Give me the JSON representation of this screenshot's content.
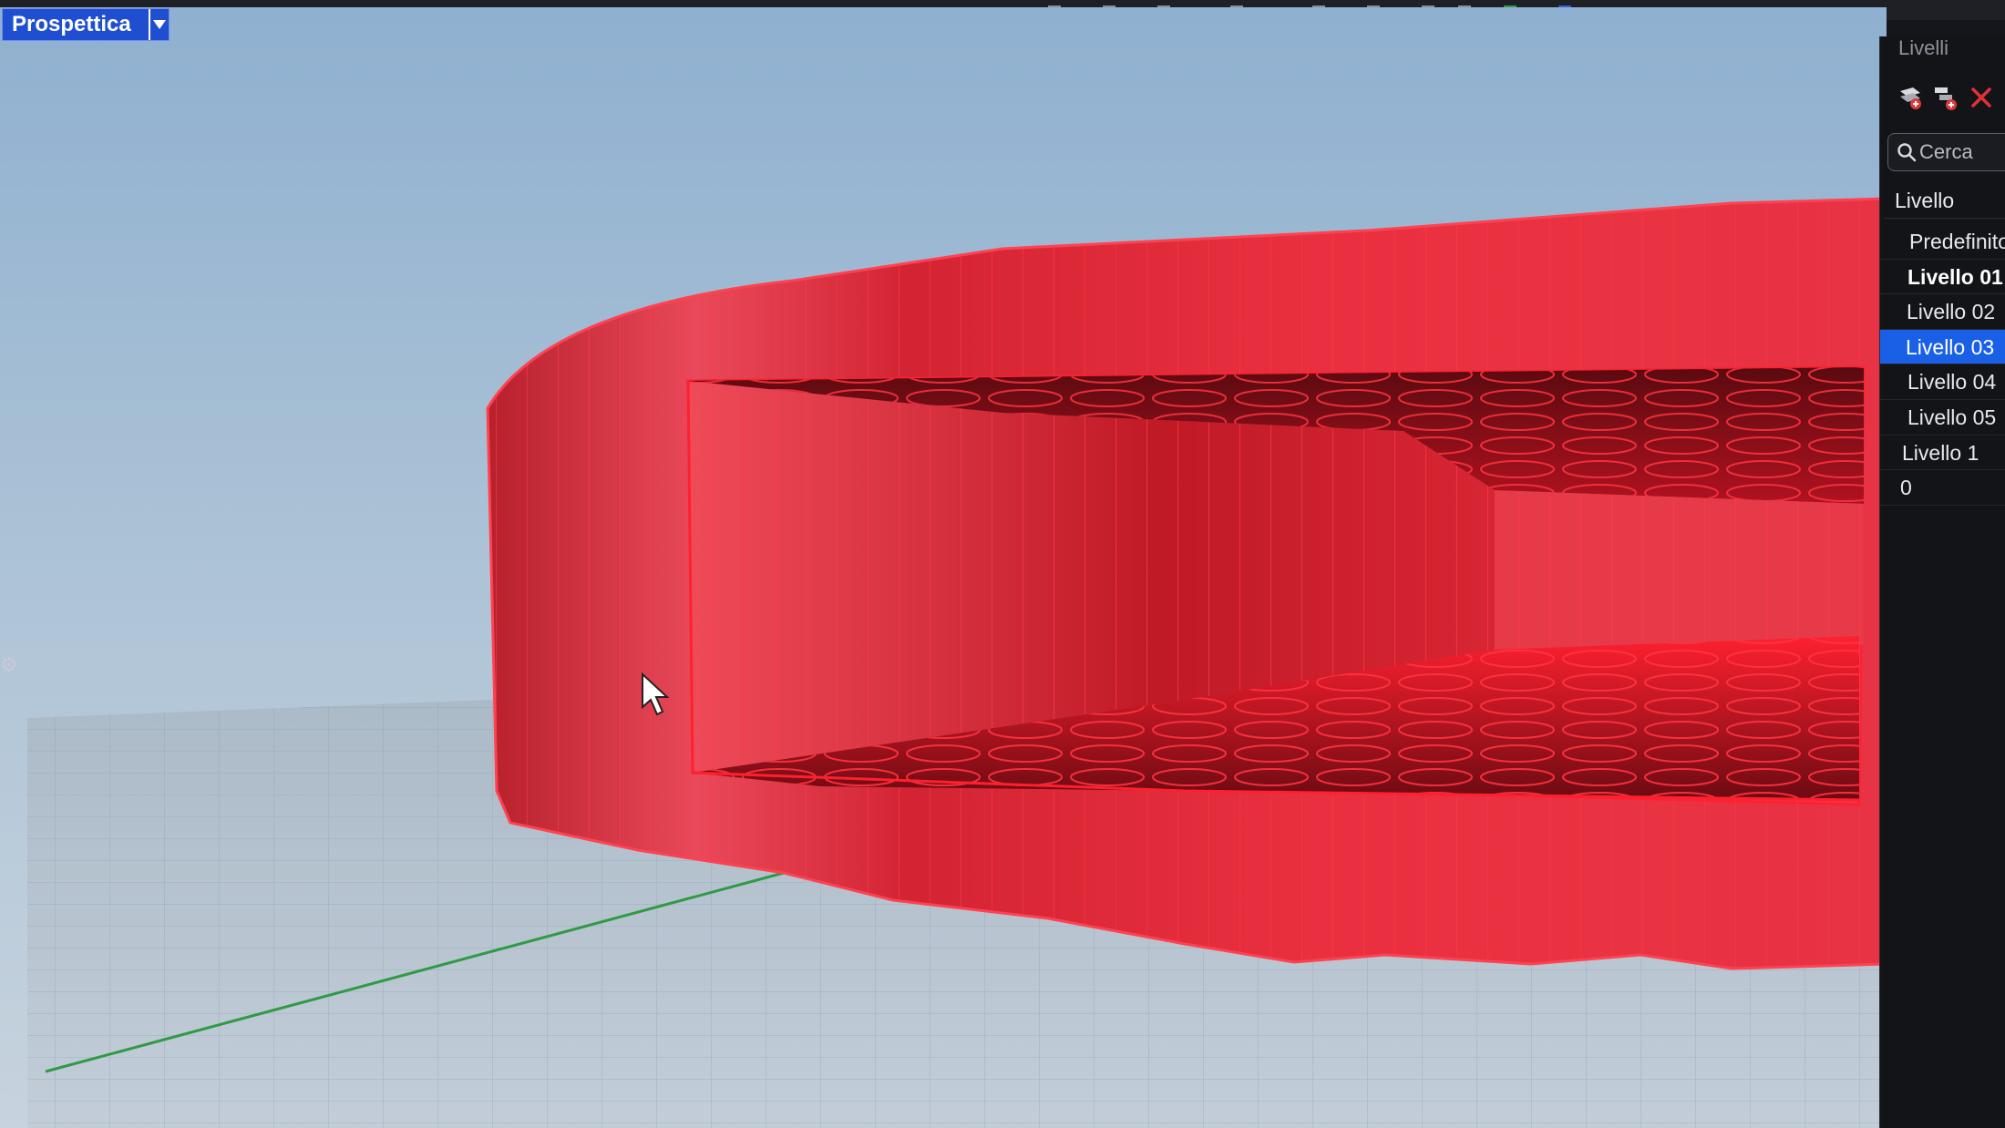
{
  "viewport": {
    "title": "Prospettica",
    "dropdown_icon": "triangle-down-icon"
  },
  "layers_panel": {
    "title": "Livelli",
    "toolbar_icons": [
      "new-layer-icon",
      "new-sublayer-icon",
      "delete-icon"
    ],
    "search": {
      "placeholder": "Cerca"
    },
    "column_header": "Livello",
    "layers": [
      {
        "name": "Predefinito",
        "indent": 1,
        "state": "normal"
      },
      {
        "name": "Livello 01",
        "indent": 1,
        "state": "current"
      },
      {
        "name": "Livello 02",
        "indent": 1,
        "state": "normal"
      },
      {
        "name": "Livello 03",
        "indent": 1,
        "state": "selected"
      },
      {
        "name": "Livello 04",
        "indent": 1,
        "state": "normal"
      },
      {
        "name": "Livello 05",
        "indent": 1,
        "state": "normal"
      },
      {
        "name": "Livello 1",
        "indent": 1,
        "state": "normal"
      },
      {
        "name": "0",
        "indent": 0,
        "state": "normal"
      }
    ]
  },
  "colors": {
    "selection": "#1960e6",
    "object": "#e01b2a",
    "viewport_sky": "#aabfd3",
    "panel_bg": "#131418"
  }
}
